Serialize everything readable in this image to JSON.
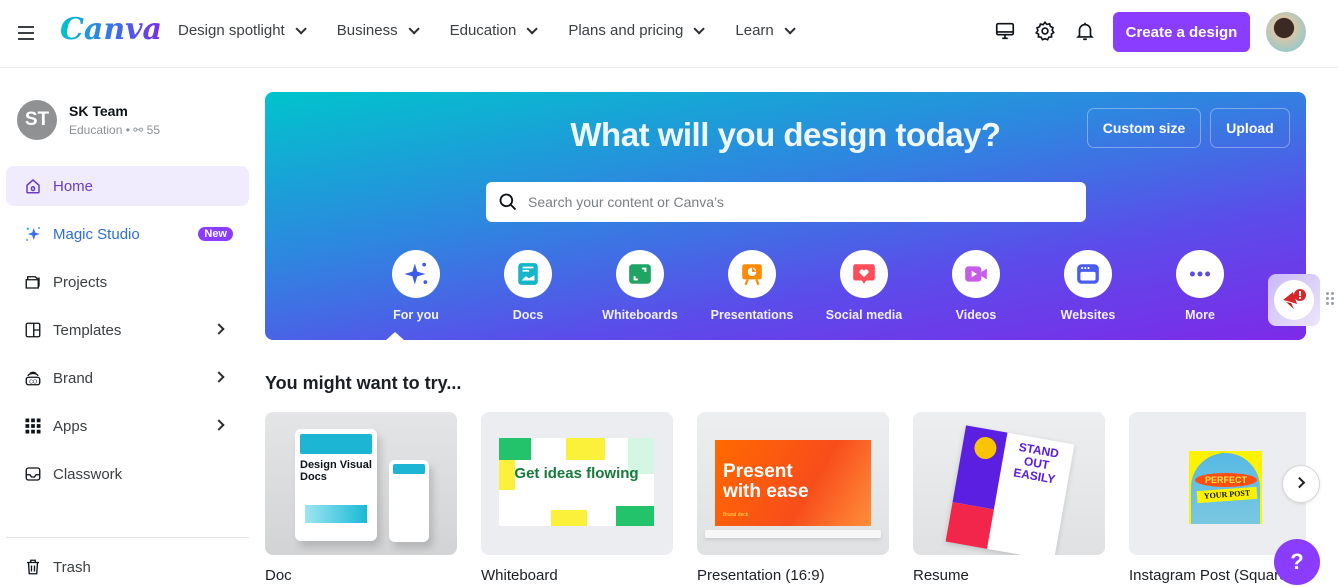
{
  "header": {
    "logo": "Canva",
    "nav": [
      {
        "label": "Design spotlight"
      },
      {
        "label": "Business"
      },
      {
        "label": "Education"
      },
      {
        "label": "Plans and pricing"
      },
      {
        "label": "Learn"
      }
    ],
    "icons": [
      "desktop-icon",
      "gear-icon",
      "bell-icon"
    ],
    "create_label": "Create a design"
  },
  "sidebar": {
    "team": {
      "initials": "ST",
      "name": "SK Team",
      "plan": "Education",
      "members": "55"
    },
    "items": [
      {
        "label": "Home",
        "icon": "home-icon",
        "active": true
      },
      {
        "label": "Magic Studio",
        "icon": "sparkle-icon",
        "badge": "New"
      },
      {
        "label": "Projects",
        "icon": "folder-icon"
      },
      {
        "label": "Templates",
        "icon": "templates-icon",
        "submenu": true
      },
      {
        "label": "Brand",
        "icon": "brand-icon",
        "submenu": true
      },
      {
        "label": "Apps",
        "icon": "apps-grid-icon",
        "submenu": true
      },
      {
        "label": "Classwork",
        "icon": "inbox-icon"
      }
    ],
    "trash_label": "Trash"
  },
  "hero": {
    "title": "What will you design today?",
    "custom_size_label": "Custom size",
    "upload_label": "Upload",
    "search_placeholder": "Search your content or Canva’s",
    "categories": [
      {
        "label": "For you",
        "color": "#3d5ae8"
      },
      {
        "label": "Docs",
        "color": "#13b5c8"
      },
      {
        "label": "Whiteboards",
        "color": "#1fa463"
      },
      {
        "label": "Presentations",
        "color": "#ff8a00"
      },
      {
        "label": "Social media",
        "color": "#ff4d5a"
      },
      {
        "label": "Videos",
        "color": "#c65ce8"
      },
      {
        "label": "Websites",
        "color": "#4a5cf0"
      },
      {
        "label": "More",
        "color": "#5b4ce8"
      }
    ]
  },
  "suggestions": {
    "title": "You might want to try...",
    "cards": [
      {
        "label": "Doc",
        "thumb_text": "Design Visual Docs"
      },
      {
        "label": "Whiteboard",
        "thumb_text": "Get ideas flowing"
      },
      {
        "label": "Presentation (16:9)",
        "thumb_text": "Present with ease",
        "thumb_sub": "Brand deck"
      },
      {
        "label": "Resume",
        "thumb_text": "STAND OUT EASILY"
      },
      {
        "label": "Instagram Post (Square)",
        "thumb_text": "PERFECT",
        "thumb_text2": "YOUR POST"
      }
    ]
  },
  "help_label": "?",
  "colors": {
    "brand_purple": "#8b3dff",
    "active_bg": "#f1ebfe"
  }
}
